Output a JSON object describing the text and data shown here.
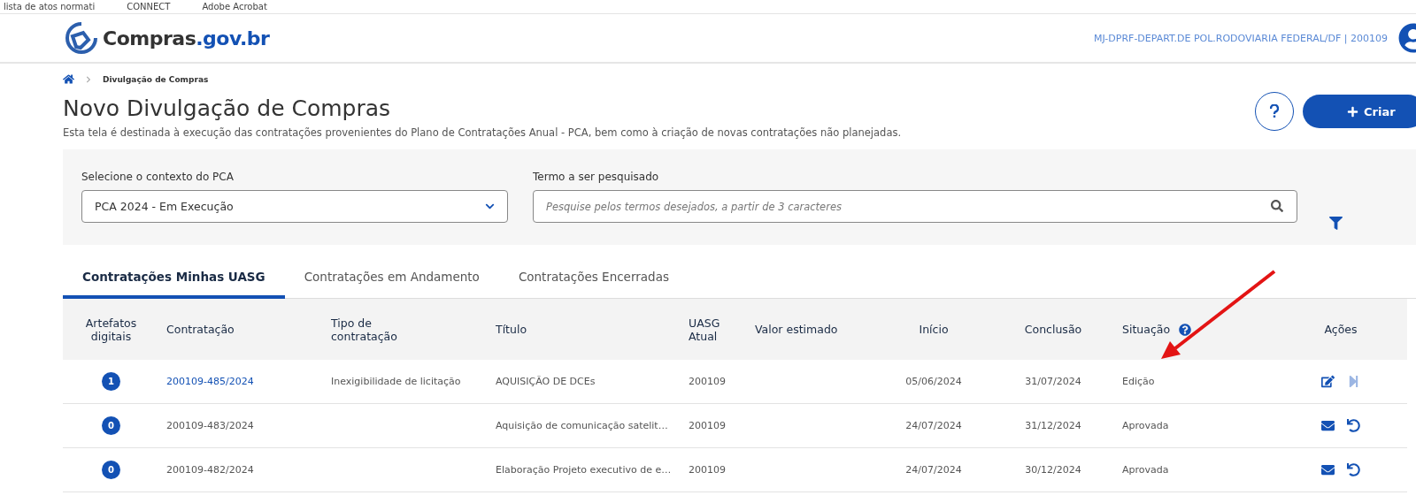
{
  "bookmarks": [
    {
      "label": "lista de atos normati"
    },
    {
      "label": "CONNECT"
    },
    {
      "label": "Adobe Acrobat"
    }
  ],
  "header": {
    "logo": {
      "name": "Compras",
      "domain": ".gov.br"
    },
    "organization": "MJ-DPRF-DEPART.DE POL.RODOVIARIA FEDERAL/DF | 200109"
  },
  "breadcrumb": [
    "Divulgação de Compras"
  ],
  "page": {
    "title": "Novo Divulgação de Compras",
    "description": "Esta tela é destinada à execução das contratações provenientes do Plano de Contratações Anual - PCA, bem como à criação de novas contratações não planejadas.",
    "create_button": "Criar"
  },
  "filters": {
    "context": {
      "label": "Selecione o contexto do PCA",
      "value": "PCA 2024 - Em Execução"
    },
    "search": {
      "label": "Termo a ser pesquisado",
      "placeholder": "Pesquise pelos termos desejados, a partir de 3 caracteres"
    }
  },
  "tabs": [
    {
      "label": "Contratações Minhas UASG",
      "selected": true
    },
    {
      "label": "Contratações em Andamento",
      "selected": false
    },
    {
      "label": "Contratações Encerradas",
      "selected": false
    }
  ],
  "table": {
    "columns": [
      "Artefatos digitais",
      "Contratação",
      "Tipo de contratação",
      "Título",
      "UASG Atual",
      "Valor estimado",
      "Início",
      "Conclusão",
      "Situação",
      "Ações"
    ],
    "rows": [
      {
        "artifacts": "1",
        "contract": "200109-485/2024",
        "link": true,
        "type": "Inexigibilidade de licitação",
        "title": "AQUISIÇÃO DE DCEs",
        "uasg": "200109",
        "start": "05/06/2024",
        "end": "31/07/2024",
        "status": "Edição",
        "actions": [
          {
            "kind": "edit",
            "disabled": false
          },
          {
            "kind": "next",
            "disabled": true
          }
        ]
      },
      {
        "artifacts": "0",
        "contract": "200109-483/2024",
        "link": false,
        "title": "Aquisição de comunicação satelit…",
        "uasg": "200109",
        "start": "24/07/2024",
        "end": "31/12/2024",
        "status": "Aprovada",
        "actions": [
          {
            "kind": "mail",
            "disabled": false
          },
          {
            "kind": "undo",
            "disabled": false
          }
        ]
      },
      {
        "artifacts": "0",
        "contract": "200109-482/2024",
        "link": false,
        "title": "Elaboração Projeto executivo de e…",
        "uasg": "200109",
        "start": "24/07/2024",
        "end": "30/12/2024",
        "status": "Aprovada",
        "actions": [
          {
            "kind": "mail",
            "disabled": false
          },
          {
            "kind": "undo",
            "disabled": false
          }
        ]
      }
    ]
  }
}
